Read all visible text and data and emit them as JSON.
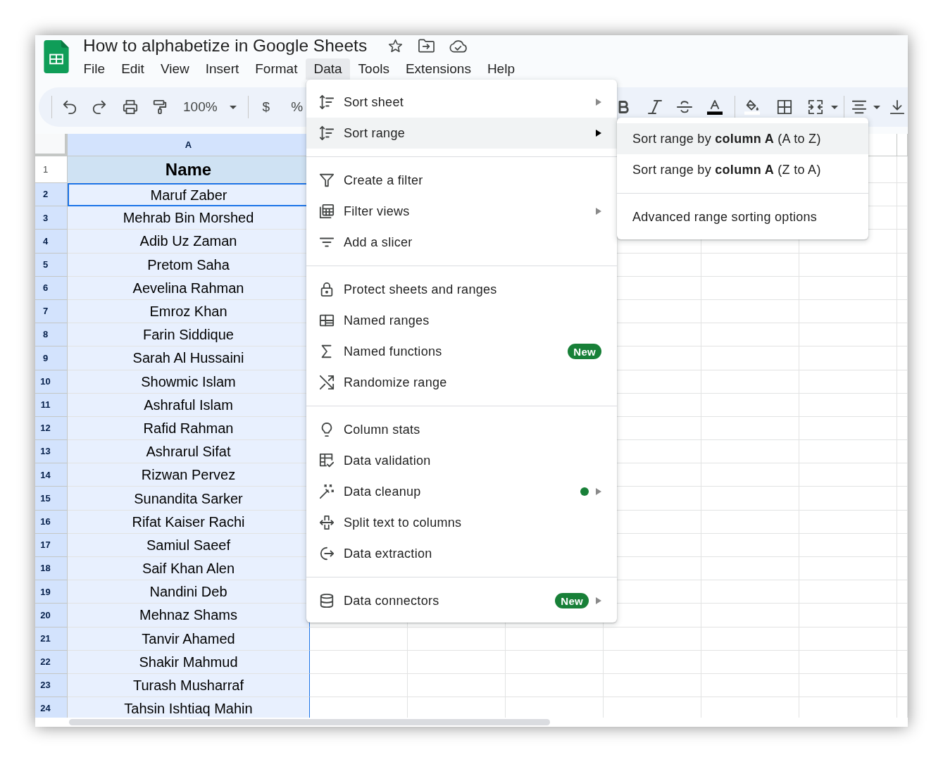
{
  "document": {
    "title": "How to alphabetize in Google Sheets"
  },
  "menu_bar": [
    {
      "label": "File",
      "selected": false
    },
    {
      "label": "Edit",
      "selected": false
    },
    {
      "label": "View",
      "selected": false
    },
    {
      "label": "Insert",
      "selected": false
    },
    {
      "label": "Format",
      "selected": false
    },
    {
      "label": "Data",
      "selected": true
    },
    {
      "label": "Tools",
      "selected": false
    },
    {
      "label": "Extensions",
      "selected": false
    },
    {
      "label": "Help",
      "selected": false
    }
  ],
  "toolbar": {
    "zoom": "100%",
    "currency": "$",
    "percent": "%"
  },
  "data_menu": {
    "sections": [
      [
        {
          "label": "Sort sheet",
          "selected": false,
          "submenu": true,
          "dot": false
        },
        {
          "label": "Sort range",
          "selected": true,
          "submenu": true,
          "dot": false
        }
      ],
      [
        {
          "label": "Create a filter",
          "selected": false,
          "submenu": false,
          "dot": false
        },
        {
          "label": "Filter views",
          "selected": false,
          "submenu": true,
          "dot": false
        },
        {
          "label": "Add a slicer",
          "selected": false,
          "submenu": false,
          "dot": false
        }
      ],
      [
        {
          "label": "Protect sheets and ranges",
          "selected": false,
          "submenu": false,
          "dot": false
        },
        {
          "label": "Named ranges",
          "selected": false,
          "submenu": false,
          "dot": false
        },
        {
          "label": "Named functions",
          "badge": "New",
          "selected": false,
          "submenu": false,
          "dot": false
        },
        {
          "label": "Randomize range",
          "selected": false,
          "submenu": false,
          "dot": false
        }
      ],
      [
        {
          "label": "Column stats",
          "selected": false,
          "submenu": false,
          "dot": false
        },
        {
          "label": "Data validation",
          "selected": false,
          "submenu": false,
          "dot": false
        },
        {
          "label": "Data cleanup",
          "selected": false,
          "submenu": true,
          "dot": true
        },
        {
          "label": "Split text to columns",
          "selected": false,
          "submenu": false,
          "dot": false
        },
        {
          "label": "Data extraction",
          "selected": false,
          "submenu": false,
          "dot": false
        }
      ],
      [
        {
          "label": "Data connectors",
          "badge": "New",
          "selected": false,
          "submenu": true,
          "dot": false
        }
      ]
    ]
  },
  "sort_range_submenu": {
    "sections": [
      [
        {
          "label": "Sort range by **column A** (A to Z)",
          "selected": true
        },
        {
          "label": "Sort range by **column A** (Z to A)",
          "selected": false
        }
      ],
      [
        {
          "label": "Advanced range sorting options",
          "selected": false
        }
      ]
    ]
  },
  "sheet": {
    "columns": [
      {
        "label": "A",
        "selected": true
      }
    ],
    "rows": [
      {
        "number": "1",
        "kind": "header",
        "value": "Name",
        "selected": false,
        "active": false
      },
      {
        "number": "2",
        "kind": "data",
        "value": "Maruf Zaber",
        "selected": true,
        "active": true
      },
      {
        "number": "3",
        "kind": "data",
        "value": "Mehrab Bin Morshed",
        "selected": true,
        "active": false
      },
      {
        "number": "4",
        "kind": "data",
        "value": "Adib Uz Zaman",
        "selected": true,
        "active": false
      },
      {
        "number": "5",
        "kind": "data",
        "value": "Pretom Saha",
        "selected": true,
        "active": false
      },
      {
        "number": "6",
        "kind": "data",
        "value": "Aevelina Rahman",
        "selected": true,
        "active": false
      },
      {
        "number": "7",
        "kind": "data",
        "value": "Emroz Khan",
        "selected": true,
        "active": false
      },
      {
        "number": "8",
        "kind": "data",
        "value": "Farin Siddique",
        "selected": true,
        "active": false
      },
      {
        "number": "9",
        "kind": "data",
        "value": "Sarah Al Hussaini",
        "selected": true,
        "active": false
      },
      {
        "number": "10",
        "kind": "data",
        "value": "Showmic Islam",
        "selected": true,
        "active": false
      },
      {
        "number": "11",
        "kind": "data",
        "value": "Ashraful Islam",
        "selected": true,
        "active": false
      },
      {
        "number": "12",
        "kind": "data",
        "value": "Rafid Rahman",
        "selected": true,
        "active": false
      },
      {
        "number": "13",
        "kind": "data",
        "value": "Ashrarul Sifat",
        "selected": true,
        "active": false
      },
      {
        "number": "14",
        "kind": "data",
        "value": "Rizwan Pervez",
        "selected": true,
        "active": false
      },
      {
        "number": "15",
        "kind": "data",
        "value": "Sunandita Sarker",
        "selected": true,
        "active": false
      },
      {
        "number": "16",
        "kind": "data",
        "value": "Rifat Kaiser Rachi",
        "selected": true,
        "active": false
      },
      {
        "number": "17",
        "kind": "data",
        "value": "Samiul Saeef",
        "selected": true,
        "active": false
      },
      {
        "number": "18",
        "kind": "data",
        "value": "Saif Khan Alen",
        "selected": true,
        "active": false
      },
      {
        "number": "19",
        "kind": "data",
        "value": "Nandini Deb",
        "selected": true,
        "active": false
      },
      {
        "number": "20",
        "kind": "data",
        "value": "Mehnaz Shams",
        "selected": true,
        "active": false
      },
      {
        "number": "21",
        "kind": "data",
        "value": "Tanvir Ahamed",
        "selected": true,
        "active": false
      },
      {
        "number": "22",
        "kind": "data",
        "value": "Shakir Mahmud",
        "selected": true,
        "active": false
      },
      {
        "number": "23",
        "kind": "data",
        "value": "Turash Musharraf",
        "selected": true,
        "active": false
      },
      {
        "number": "24",
        "kind": "data",
        "value": "Tahsin Ishtiaq Mahin",
        "selected": true,
        "active": false
      }
    ]
  }
}
